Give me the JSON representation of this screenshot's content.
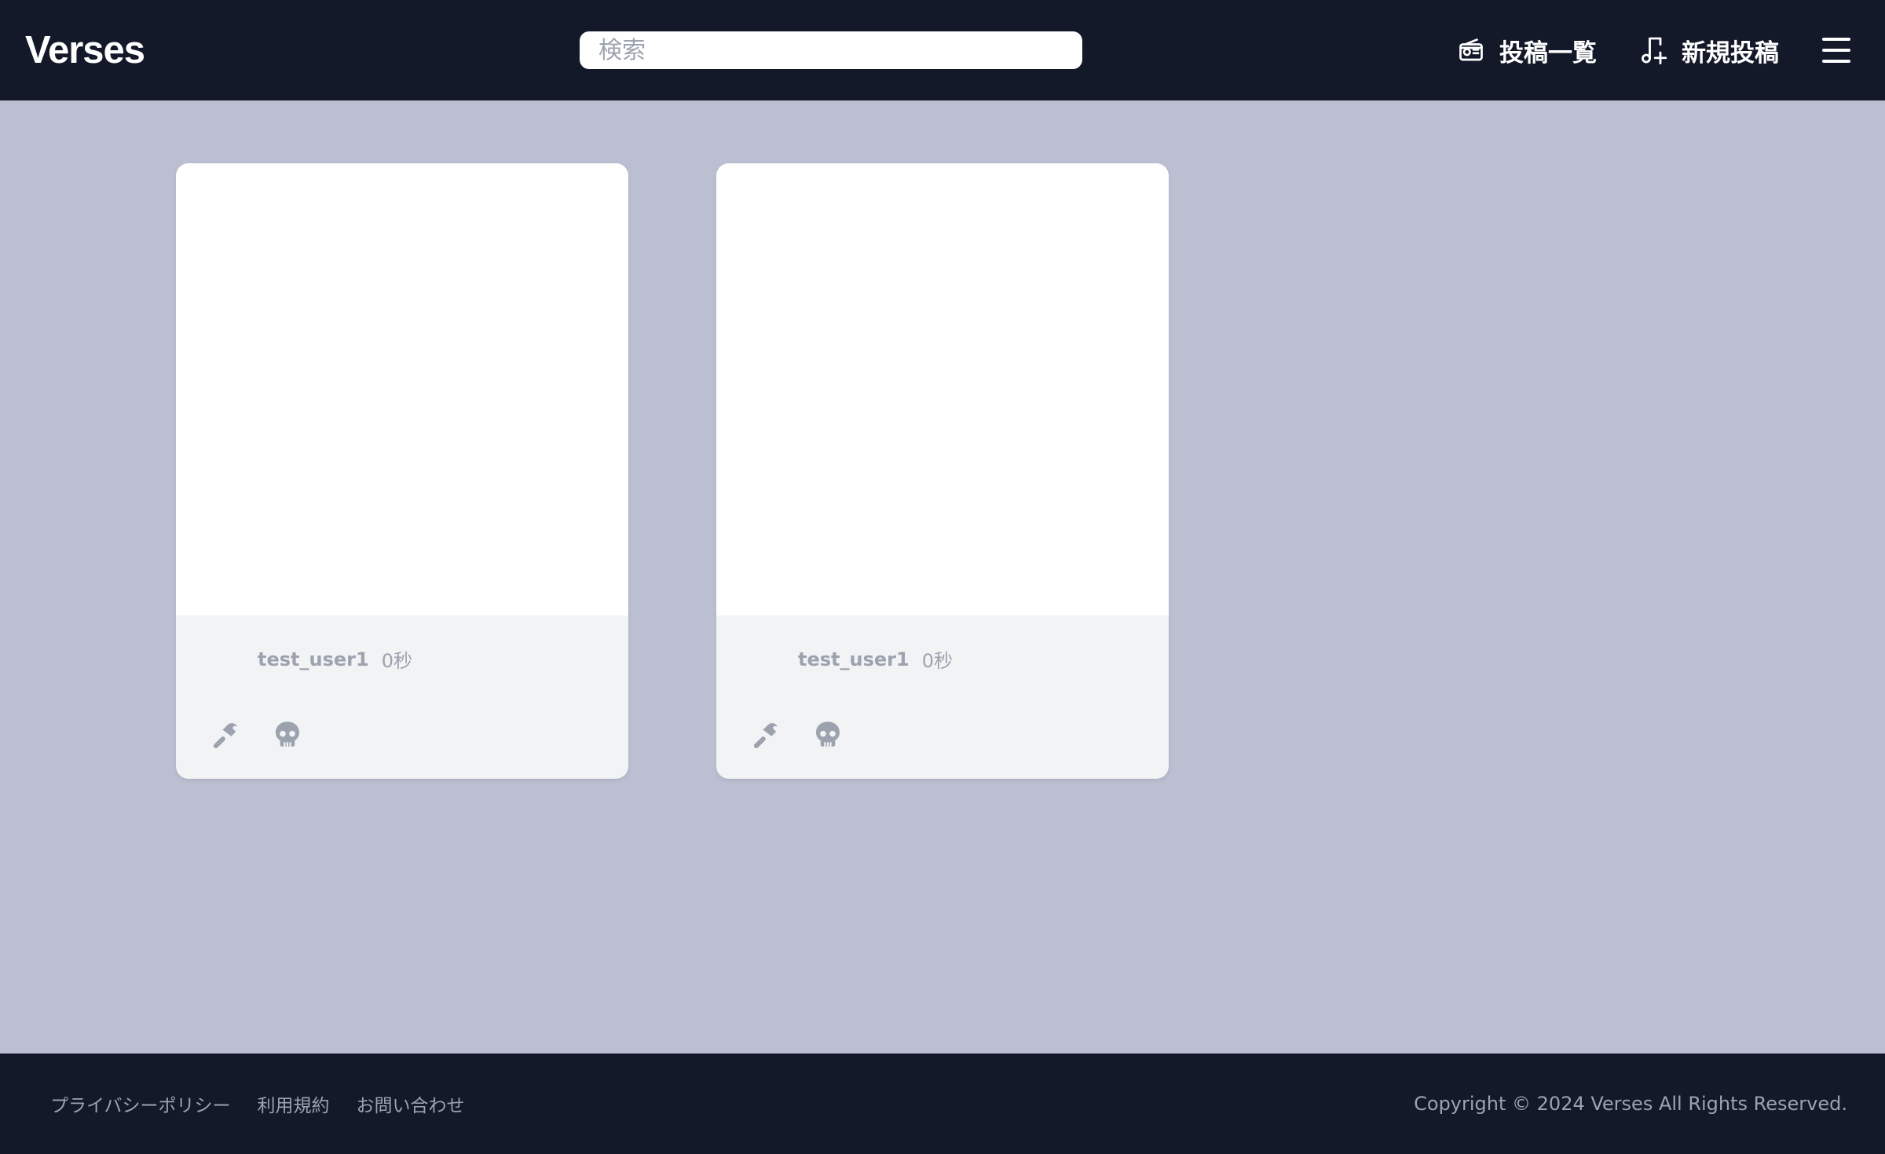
{
  "header": {
    "logo": "Verses",
    "search_placeholder": "検索",
    "nav": {
      "posts_label": "投稿一覧",
      "posts_icon": "radio-icon",
      "new_post_label": "新規投稿",
      "new_post_icon": "music-note-plus-icon",
      "menu_icon": "hamburger-menu-icon"
    }
  },
  "posts": [
    {
      "username": "test_user1",
      "time": "0秒",
      "actions": [
        "hammer-icon",
        "skull-icon"
      ]
    },
    {
      "username": "test_user1",
      "time": "0秒",
      "actions": [
        "hammer-icon",
        "skull-icon"
      ]
    }
  ],
  "footer": {
    "links": [
      "プライバシーポリシー",
      "利用規約",
      "お問い合わせ"
    ],
    "copyright": "Copyright © 2024 Verses All Rights Reserved."
  },
  "colors": {
    "header_bg": "#131929",
    "page_bg": "#bcbfd2",
    "card_footer_bg": "#f2f3f5",
    "muted_text": "#9ca3af"
  }
}
